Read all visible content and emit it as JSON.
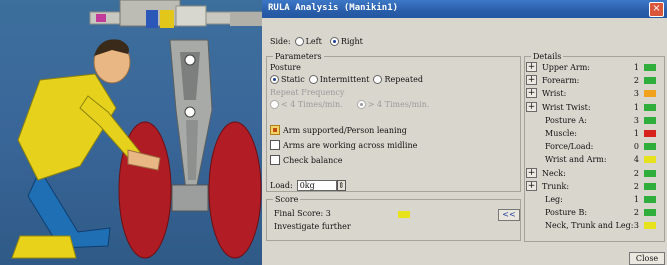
{
  "window": {
    "title": "RULA Analysis (Manikin1)",
    "close_glyph": "×"
  },
  "side": {
    "label": "Side:",
    "options": [
      "Left",
      "Right"
    ],
    "selected": "Right"
  },
  "parameters": {
    "group_label": "Parameters",
    "posture_label": "Posture",
    "posture_options": [
      "Static",
      "Intermittent",
      "Repeated"
    ],
    "posture_selected": "Static",
    "repeat_label": "Repeat Frequency",
    "repeat_options": [
      "< 4 Times/min.",
      "> 4 Times/min."
    ],
    "repeat_selected": "> 4 Times/min.",
    "checks": [
      {
        "label": "Arm supported/Person leaning",
        "checked": true
      },
      {
        "label": "Arms are working across midline",
        "checked": false
      },
      {
        "label": "Check balance",
        "checked": false
      }
    ],
    "load_label": "Load:",
    "load_value": "0kg",
    "spin_glyph": "⇕"
  },
  "score": {
    "group_label": "Score",
    "final_label": "Final Score: 3",
    "final_color": "#e8e21c",
    "verdict": "Investigate further",
    "back_button": "<<"
  },
  "details": {
    "group_label": "Details",
    "items": [
      {
        "label": "Upper Arm:",
        "value": "1",
        "color": "#2fae3b",
        "expandable": true
      },
      {
        "label": "Forearm:",
        "value": "2",
        "color": "#2fae3b",
        "expandable": true
      },
      {
        "label": "Wrist:",
        "value": "3",
        "color": "#f0a21d",
        "expandable": true
      },
      {
        "label": "Wrist Twist:",
        "value": "1",
        "color": "#2fae3b",
        "expandable": true
      },
      {
        "label": "Posture A:",
        "value": "3",
        "color": "#2fae3b",
        "expandable": false
      },
      {
        "label": "Muscle:",
        "value": "1",
        "color": "#d6211d",
        "expandable": false
      },
      {
        "label": "Force/Load:",
        "value": "0",
        "color": "#2fae3b",
        "expandable": false
      },
      {
        "label": "Wrist and Arm:",
        "value": "4",
        "color": "#e8e21c",
        "expandable": false
      },
      {
        "label": "Neck:",
        "value": "2",
        "color": "#2fae3b",
        "expandable": true
      },
      {
        "label": "Trunk:",
        "value": "2",
        "color": "#2fae3b",
        "expandable": true
      },
      {
        "label": "Leg:",
        "value": "1",
        "color": "#2fae3b",
        "expandable": false
      },
      {
        "label": "Posture B:",
        "value": "2",
        "color": "#2fae3b",
        "expandable": false
      },
      {
        "label": "Neck, Trunk and Leg:",
        "value": "3",
        "color": "#e8e21c",
        "expandable": false
      }
    ],
    "plus_glyph": "+"
  },
  "close_button": "Close",
  "colors": {
    "title_bar": "#2a5eaa",
    "dialog_bg": "#d9d6cd",
    "viewport_bg": "#3a679a"
  }
}
